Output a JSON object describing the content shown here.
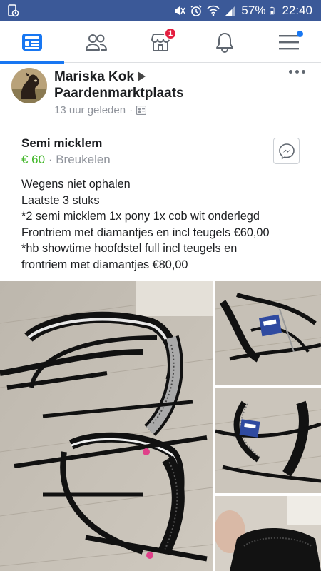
{
  "status_bar": {
    "battery": "57%",
    "time": "22:40"
  },
  "nav_tabs": [
    {
      "name": "feed",
      "icon": "news-feed-icon",
      "active": true
    },
    {
      "name": "friends",
      "icon": "friends-icon"
    },
    {
      "name": "marketplace",
      "icon": "marketplace-icon",
      "badge": "1"
    },
    {
      "name": "notifications",
      "icon": "bell-icon"
    },
    {
      "name": "menu",
      "icon": "hamburger-menu-icon",
      "dot": true
    }
  ],
  "post": {
    "author": "Mariska Kok",
    "group": "Paardenmarktplaats",
    "time": "13 uur geleden",
    "separator": "·",
    "title": "Semi micklem",
    "price": "€ 60",
    "location_sep": " · ",
    "location": "Breukelen",
    "body": "Wegens niet ophalen\nLaatste 3 stuks\n*2 semi micklem 1x pony 1x cob wit onderlegd\nFrontriem met diamantjes en incl teugels €60,00\n*hb showtime hoofdstel full incl teugels en\nfrontriem met diamantjes €80,00"
  },
  "colors": {
    "fb_blue": "#3b5998",
    "active_blue": "#1877f2",
    "price_green": "#42b72a",
    "badge_red": "#e41e3f"
  }
}
